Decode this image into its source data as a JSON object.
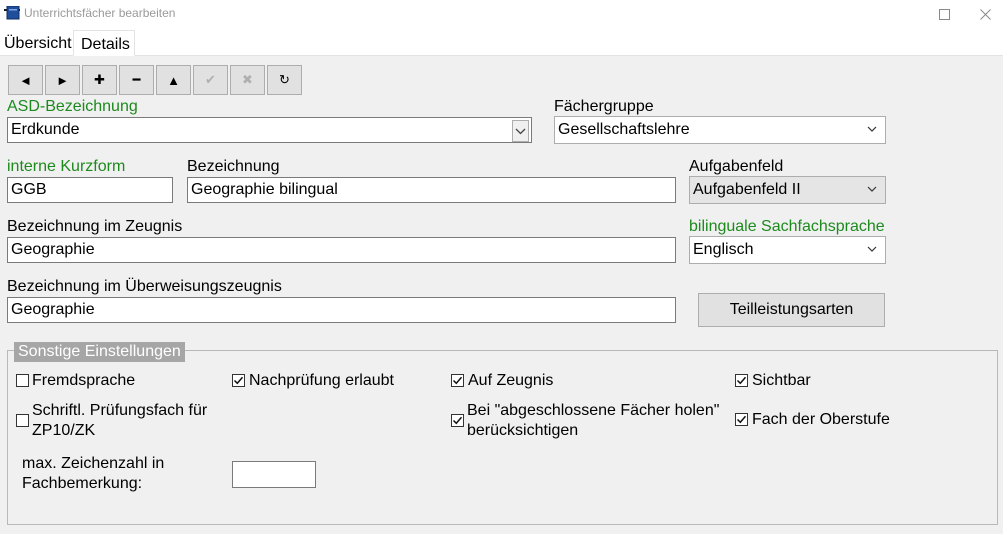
{
  "window": {
    "title": "Unterrichtsfächer bearbeiten",
    "icon": "app-icon"
  },
  "tabs": [
    {
      "label": "Übersicht",
      "active": false
    },
    {
      "label": "Details",
      "active": true
    }
  ],
  "toolbar": [
    {
      "name": "first-record-button",
      "icon": "triangle-left-icon",
      "glyph": "◄",
      "enabled": true
    },
    {
      "name": "next-record-button",
      "icon": "triangle-right-icon",
      "glyph": "►",
      "enabled": true
    },
    {
      "name": "add-button",
      "icon": "plus-icon",
      "glyph": "✚",
      "enabled": true
    },
    {
      "name": "delete-button",
      "icon": "minus-icon",
      "glyph": "━",
      "enabled": true
    },
    {
      "name": "move-up-button",
      "icon": "triangle-up-icon",
      "glyph": "▲",
      "enabled": true
    },
    {
      "name": "confirm-button",
      "icon": "checkmark-icon",
      "glyph": "✔",
      "enabled": false
    },
    {
      "name": "cancel-button",
      "icon": "cross-icon",
      "glyph": "✖",
      "enabled": false
    },
    {
      "name": "refresh-button",
      "icon": "refresh-icon",
      "glyph": "↻",
      "enabled": true
    }
  ],
  "form": {
    "asd": {
      "label": "ASD-Bezeichnung",
      "value": "Erdkunde"
    },
    "faechergruppe": {
      "label": "Fächergruppe",
      "value": "Gesellschaftslehre"
    },
    "kurzform": {
      "label": "interne Kurzform",
      "value": "GGB"
    },
    "bezeichnung": {
      "label": "Bezeichnung",
      "value": "Geographie bilingual"
    },
    "aufgabenfeld": {
      "label": "Aufgabenfeld",
      "value": "Aufgabenfeld II"
    },
    "zeugnis": {
      "label": "Bezeichnung im Zeugnis",
      "value": "Geographie"
    },
    "sprache": {
      "label": "bilinguale Sachfachsprache",
      "value": "Englisch"
    },
    "ueberweisung": {
      "label": "Bezeichnung im Überweisungszeugnis",
      "value": "Geographie"
    },
    "teilleistung_button": "Teilleistungsarten"
  },
  "sonstige": {
    "legend": "Sonstige Einstellungen",
    "checkboxes": {
      "fremdsprache": {
        "label": "Fremdsprache",
        "checked": false
      },
      "nachpruefung": {
        "label": "Nachprüfung erlaubt",
        "checked": true
      },
      "auf_zeugnis": {
        "label": "Auf Zeugnis",
        "checked": true
      },
      "sichtbar": {
        "label": "Sichtbar",
        "checked": true
      },
      "pruefungsfach": {
        "label_line1": "Schriftl. Prüfungsfach für",
        "label_line2": "ZP10/ZK",
        "checked": false
      },
      "abgeschlossen": {
        "label_line1": "Bei \"abgeschlossene Fächer holen\"",
        "label_line2": "berücksichtigen",
        "checked": true
      },
      "oberstufe": {
        "label": "Fach der Oberstufe",
        "checked": true
      }
    },
    "max_zeichen": {
      "label_line1": "max. Zeichenzahl in",
      "label_line2": "Fachbemerkung:",
      "value": ""
    }
  },
  "colors": {
    "accent_label": "#1d8a1d",
    "background": "#f0f0f0"
  }
}
